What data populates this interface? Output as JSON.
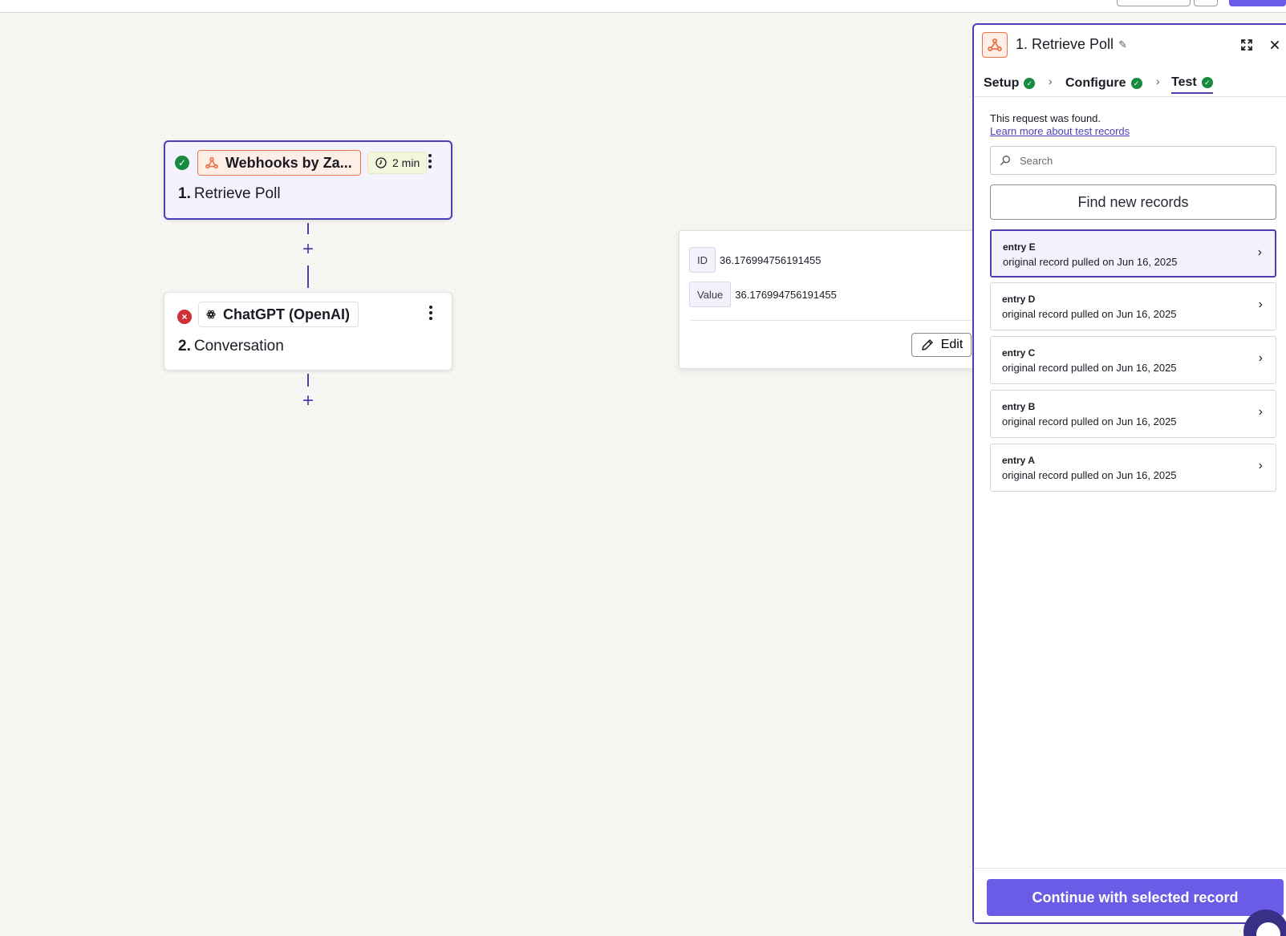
{
  "colors": {
    "accent": "#4b3fb5",
    "primary_button": "#6b5ce7",
    "success": "#168b3d",
    "error": "#d12f38",
    "webhook_orange": "#e8744a"
  },
  "canvas": {
    "steps": [
      {
        "status": "success",
        "status_icon": "check-icon",
        "app_icon": "webhook-icon",
        "app_name": "Webhooks by Za...",
        "time_icon": "clock-icon",
        "time_label": "2 min",
        "number": "1.",
        "title": "Retrieve Poll"
      },
      {
        "status": "error",
        "status_icon": "x-icon",
        "app_icon": "openai-icon",
        "app_name": "ChatGPT (OpenAI)",
        "number": "2.",
        "title": "Conversation"
      }
    ],
    "add_step_symbol": "+"
  },
  "record_detail": {
    "fields": [
      {
        "key": "ID",
        "value": "36.176994756191455"
      },
      {
        "key": "Value",
        "value": "36.176994756191455"
      }
    ],
    "edit_label": "Edit"
  },
  "panel": {
    "title": "1. Retrieve Poll",
    "tabs": [
      {
        "label": "Setup",
        "complete": true
      },
      {
        "label": "Configure",
        "complete": true
      },
      {
        "label": "Test",
        "complete": true,
        "active": true
      }
    ],
    "found_text": "This request was found.",
    "learn_link": "Learn more about test records",
    "search_placeholder": "Search",
    "find_button": "Find new records",
    "records": [
      {
        "title": "entry E",
        "subtitle": "original record pulled on Jun 16, 2025",
        "selected": true
      },
      {
        "title": "entry D",
        "subtitle": "original record pulled on Jun 16, 2025",
        "selected": false
      },
      {
        "title": "entry C",
        "subtitle": "original record pulled on Jun 16, 2025",
        "selected": false
      },
      {
        "title": "entry B",
        "subtitle": "original record pulled on Jun 16, 2025",
        "selected": false
      },
      {
        "title": "entry A",
        "subtitle": "original record pulled on Jun 16, 2025",
        "selected": false
      }
    ],
    "continue_button": "Continue with selected record"
  }
}
